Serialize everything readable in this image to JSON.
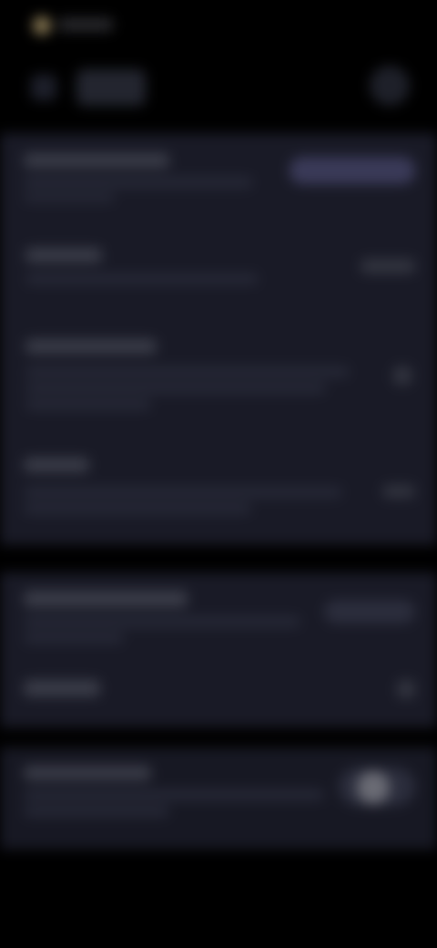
{
  "colors": {
    "background": "#000000",
    "panel": "#191a26",
    "panel_alt": "#171823",
    "text_placeholder": "#32343f",
    "accent": "#3a3a58"
  },
  "status_bar": {
    "icons": [
      "status-dot-icon"
    ]
  },
  "top_bar": {
    "icons": [
      "back-arrow-icon",
      "more-icon"
    ]
  },
  "settings_rows": [
    {
      "id": "row-1",
      "control": "pill"
    },
    {
      "id": "row-2",
      "control": "value"
    },
    {
      "id": "row-3",
      "control": "chevron"
    },
    {
      "id": "row-4",
      "control": "chevron"
    },
    {
      "id": "row-5",
      "control": "pill"
    },
    {
      "id": "row-6",
      "control": "chevron"
    },
    {
      "id": "row-7",
      "control": "toggle"
    }
  ]
}
